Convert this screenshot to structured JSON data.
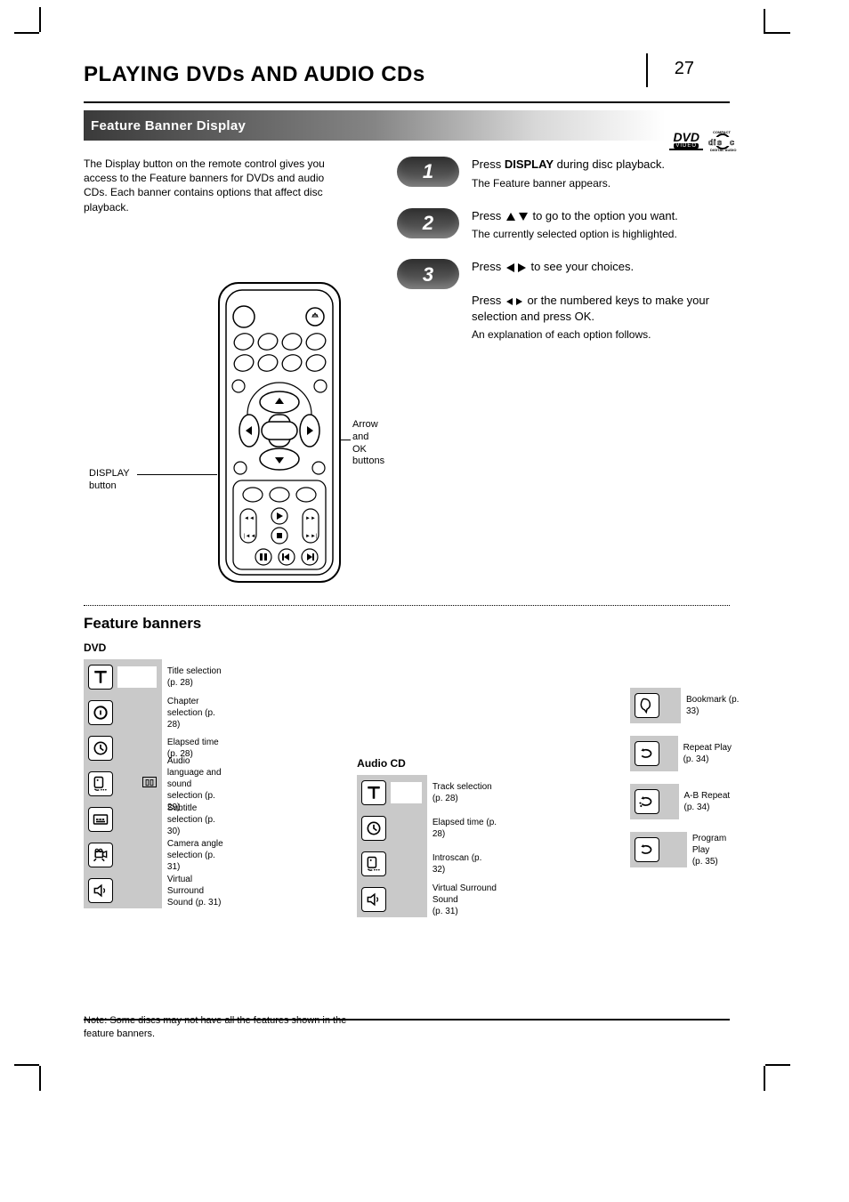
{
  "header": {
    "title": "PLAYING DVDs AND AUDIO CDs",
    "page_number": "27",
    "section": "Feature Banner Display"
  },
  "intro": "The Display button on the remote control gives you access to the Feature banners for DVDs and audio CDs. Each banner contains options that affect disc playback.",
  "remote": {
    "right_callout": "Arrow \nand OK \nbuttons",
    "left_callout": "DISPLAY \nbutton"
  },
  "steps": [
    {
      "num": "1",
      "head_pre": "Press ",
      "head_bold": "DISPLAY",
      "head_post": " during disc playback.",
      "sub": "The Feature banner appears."
    },
    {
      "num": "2",
      "head_pre": "Press ",
      "arrows": "ud",
      "head_post": " to go to the option you want.",
      "sub": "The currently selected option is highlighted."
    },
    {
      "num": "3",
      "head_pre": "Press ",
      "arrows": "lr",
      "head_post": " to see your choices.",
      "sub": ""
    },
    {
      "num": "",
      "head_pre": "Press ",
      "arrows": "lrsm",
      "head_post": " or the numbered keys to make your selection and press OK.",
      "sub": "An explanation of each option follows."
    }
  ],
  "feature_heading": "Feature banners",
  "dvd_banner": {
    "title": "DVD",
    "items": [
      {
        "icon": "title-icon",
        "highlight": true,
        "caption": "Title selection (p. 28)"
      },
      {
        "icon": "chapter-icon",
        "highlight": false,
        "caption": "Chapter selection (p. 28)"
      },
      {
        "icon": "clock-icon",
        "highlight": false,
        "caption": "Elapsed time (p. 28)"
      },
      {
        "icon": "audio-icon",
        "highlight": false,
        "extra": "dd",
        "caption": "Audio language and sound selection (p. 29)"
      },
      {
        "icon": "subtitle-icon",
        "highlight": false,
        "caption": "Subtitle selection (p. 30)"
      },
      {
        "icon": "camera-icon",
        "highlight": false,
        "caption": "Camera angle selection (p. 31)"
      },
      {
        "icon": "sound-icon",
        "highlight": false,
        "caption": "Virtual Surround Sound (p. 31)"
      }
    ]
  },
  "cd_banner": {
    "title": "Audio CD",
    "items": [
      {
        "icon": "title-icon",
        "highlight": true,
        "caption": "Track selection (p. 28)"
      },
      {
        "icon": "clock-icon",
        "highlight": false,
        "caption": "Elapsed time (p. 28)"
      },
      {
        "icon": "audio-icon",
        "highlight": false,
        "caption": "Introscan (p. 32)"
      },
      {
        "icon": "sound-icon",
        "highlight": false,
        "caption": "Virtual Surround Sound \n(p. 31)"
      }
    ]
  },
  "repeat_banner": {
    "items": [
      {
        "icon": "bookmark-icon",
        "caption": "Bookmark (p. 33)"
      },
      {
        "icon": "repeat-icon",
        "caption": "Repeat Play (p. 34)"
      },
      {
        "icon": "ab-repeat-icon",
        "caption": "A-B Repeat (p. 34)"
      },
      {
        "icon": "program-icon",
        "caption": "Program Play \n(p. 35)"
      }
    ]
  },
  "note": "Note: Some discs may not have all the features shown in the feature banners.",
  "page_foot": ""
}
